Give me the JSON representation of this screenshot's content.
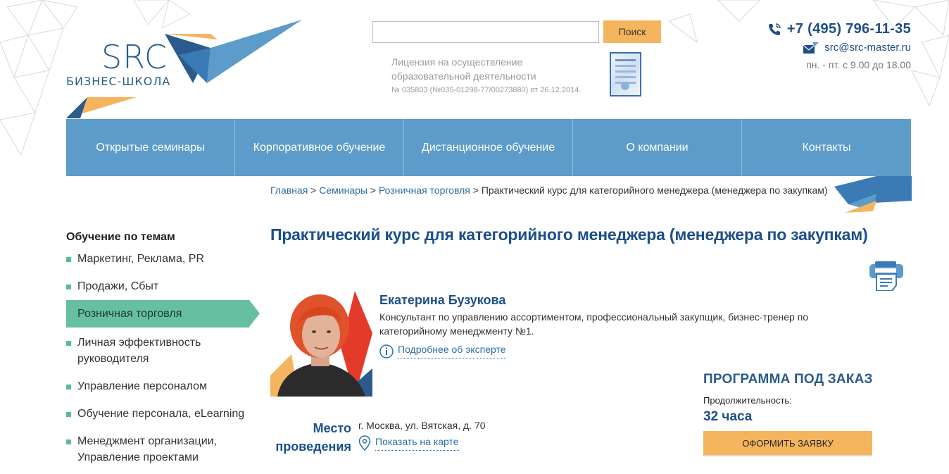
{
  "logo": {
    "brand": "SRC",
    "subtitle": "БИЗНЕС-ШКОЛА"
  },
  "search": {
    "placeholder": "",
    "button_label": "Поиск"
  },
  "license": {
    "line1": "Лицензия на осуществление образовательной деятельности",
    "line2": "№ 035803 (№035-01298-77/00273880) от 26.12.2014."
  },
  "contacts": {
    "phone": "+7 (495) 796-11-35",
    "email": "src@src-master.ru",
    "hours": "пн. - пт. с 9.00 до 18.00"
  },
  "nav": {
    "items": [
      {
        "label": "Открытые семинары"
      },
      {
        "label": "Корпоративное обучение"
      },
      {
        "label": "Дистанционное обучение"
      },
      {
        "label": "О компании"
      },
      {
        "label": "Контакты"
      }
    ]
  },
  "breadcrumb": {
    "home": "Главная",
    "sep": " > ",
    "seminars": "Семинары",
    "retail": "Розничная торговля",
    "current": "Практический курс для категорийного менеджера (менеджера по закупкам)"
  },
  "page_title": "Практический курс для категорийного менеджера (менеджера по закупкам)",
  "sidebar": {
    "title": "Обучение по темам",
    "items": [
      {
        "label": "Маркетинг, Реклама, PR"
      },
      {
        "label": "Продажи, Сбыт"
      },
      {
        "label": "Розничная торговля"
      },
      {
        "label": "Личная эффективность руководителя"
      },
      {
        "label": "Управление персоналом"
      },
      {
        "label": "Обучение персонала, eLearning"
      },
      {
        "label": "Менеджмент организации, Управление проектами"
      }
    ]
  },
  "expert": {
    "name": "Екатерина Бузукова",
    "description": "Консультант по управлению ассортиментом, профессиональный закупщик, бизнес-тренер по категорийному менеджменту №1.",
    "more_link": "Подробнее об эксперте"
  },
  "program": {
    "title": "ПРОГРАММА ПОД ЗАКАЗ",
    "duration_label": "Продолжительность:",
    "duration_value": "32 часа",
    "order_button": "ОФОРМИТЬ ЗАЯВКУ"
  },
  "venue": {
    "label_line1": "Место",
    "label_line2": "проведения",
    "address": "г. Москва, ул. Вятская, д. 70",
    "map_link": "Показать на карте"
  },
  "colors": {
    "nav_bg": "#5d9cca",
    "accent_orange": "#f5b55f",
    "title_blue": "#1d4f89",
    "sidebar_active": "#66bfa0",
    "link_blue": "#2a6ea6"
  }
}
